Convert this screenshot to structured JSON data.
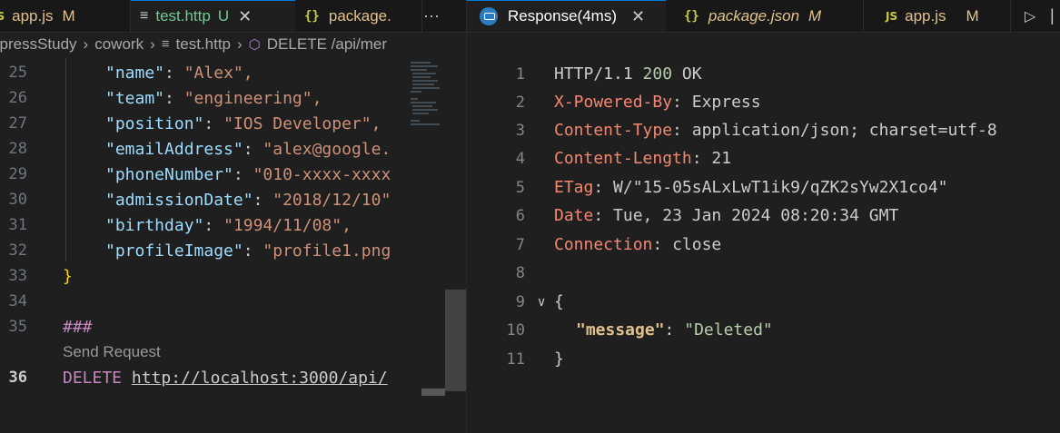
{
  "left_tabs": [
    {
      "icon": "JS",
      "label": "app.js",
      "badge": "M"
    },
    {
      "icon": "≡",
      "label": "test.http",
      "badge": "U",
      "close": "✕"
    },
    {
      "icon": "{}",
      "label": "package.",
      "more": "···"
    }
  ],
  "breadcrumb": [
    "xpressStudy",
    "cowork",
    "test.http",
    "DELETE /api/mer"
  ],
  "editor_lines": [
    {
      "num": "25",
      "key": "\"name\"",
      "value": "\"Alex\","
    },
    {
      "num": "26",
      "key": "\"team\"",
      "value": "\"engineering\","
    },
    {
      "num": "27",
      "key": "\"position\"",
      "value": "\"IOS Developer\","
    },
    {
      "num": "28",
      "key": "\"emailAddress\"",
      "value": "\"alex@google."
    },
    {
      "num": "29",
      "key": "\"phoneNumber\"",
      "value": "\"010-xxxx-xxxx"
    },
    {
      "num": "30",
      "key": "\"admissionDate\"",
      "value": "\"2018/12/10\""
    },
    {
      "num": "31",
      "key": "\"birthday\"",
      "value": "\"1994/11/08\","
    },
    {
      "num": "32",
      "key": "\"profileImage\"",
      "value": "\"profile1.png"
    }
  ],
  "line33": {
    "num": "33",
    "text": "}"
  },
  "line34": {
    "num": "34"
  },
  "line35": {
    "num": "35",
    "text": "###"
  },
  "codelens": "Send Request",
  "line36": {
    "num": "36",
    "method": "DELETE",
    "url": "http://localhost:3000/api/"
  },
  "right_tabs": [
    {
      "label": "Response(4ms)",
      "close": "✕"
    },
    {
      "icon": "{}",
      "label": "package.json",
      "badge": "M"
    },
    {
      "icon": "JS",
      "label": "app.js",
      "badge": "M"
    }
  ],
  "response": {
    "status_line": {
      "num": "1",
      "proto": "HTTP/1.1",
      "code": "200",
      "text": "OK"
    },
    "headers": [
      {
        "num": "2",
        "name": "X-Powered-By",
        "value": "Express"
      },
      {
        "num": "3",
        "name": "Content-Type",
        "value": "application/json; charset=utf-8"
      },
      {
        "num": "4",
        "name": "Content-Length",
        "value": "21"
      },
      {
        "num": "5",
        "name": "ETag",
        "value": "W/\"15-05sALxLwT1ik9/qZK2sYw2X1co4\""
      },
      {
        "num": "6",
        "name": "Date",
        "value": "Tue, 23 Jan 2024 08:20:34 GMT"
      },
      {
        "num": "7",
        "name": "Connection",
        "value": "close"
      }
    ],
    "blank_num": "8",
    "open_num": "9",
    "open_text": "{",
    "body_num": "10",
    "body_key": "\"message\"",
    "body_value": "\"Deleted\"",
    "close_num": "11",
    "close_text": "}"
  },
  "colors": {
    "accent": "#0078d4",
    "modified": "#e2c08d",
    "untracked": "#73c991",
    "header_name": "#f48771"
  }
}
